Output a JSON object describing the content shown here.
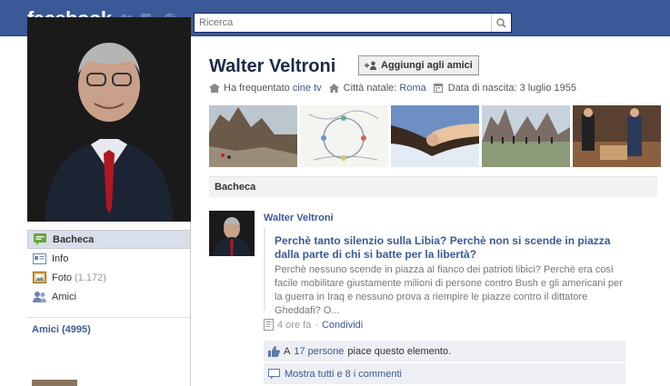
{
  "topbar": {
    "logo": "facebook",
    "search_placeholder": "Ricerca",
    "jewels": [
      "friend-requests-icon",
      "messages-icon",
      "notifications-icon"
    ]
  },
  "profile": {
    "name": "Walter Veltroni",
    "add_friend_label": "Aggiungi agli amici",
    "info": {
      "studied_prefix": "Ha frequentato",
      "studied_value": "cine tv",
      "hometown_prefix": "Città natale:",
      "hometown_value": "Roma",
      "birthday": "Data di nascita: 3 luglio 1955"
    }
  },
  "nav": {
    "items": [
      {
        "label": "Bacheca",
        "icon": "wall-icon",
        "count": ""
      },
      {
        "label": "Info",
        "icon": "info-icon",
        "count": ""
      },
      {
        "label": "Foto",
        "icon": "photos-icon",
        "count": "(1.172)"
      },
      {
        "label": "Amici",
        "icon": "friends-icon",
        "count": ""
      }
    ],
    "friends_header": "Amici (4995)"
  },
  "wall": {
    "header": "Bacheca",
    "post": {
      "author": "Walter Veltroni",
      "link_title": "Perchè tanto silenzio sulla Libia? Perchè non si scende in piazza dalla parte di chi si batte per la libertà?",
      "link_desc": "Perchè nessuno scende in piazza al fianco dei patrioti libici? Perchè era così facile mobilitare giustamente milioni di persone contro Bush e gli americani per la guerra in Iraq e nessuno prova a riempire le piazze contro il dittatore Gheddafi? O...",
      "time": "4 ore fa",
      "separator": "·",
      "share": "Condividi",
      "likes_prefix": "A",
      "likes_people": "17 persone",
      "likes_suffix": "piace questo elemento.",
      "comments": "Mostra tutti e 8 i commenti"
    }
  },
  "colors": {
    "brand": "#3b5998",
    "link": "#3b5998",
    "nav_active": "#d8dfea",
    "ufi_bg": "#edeff4"
  }
}
